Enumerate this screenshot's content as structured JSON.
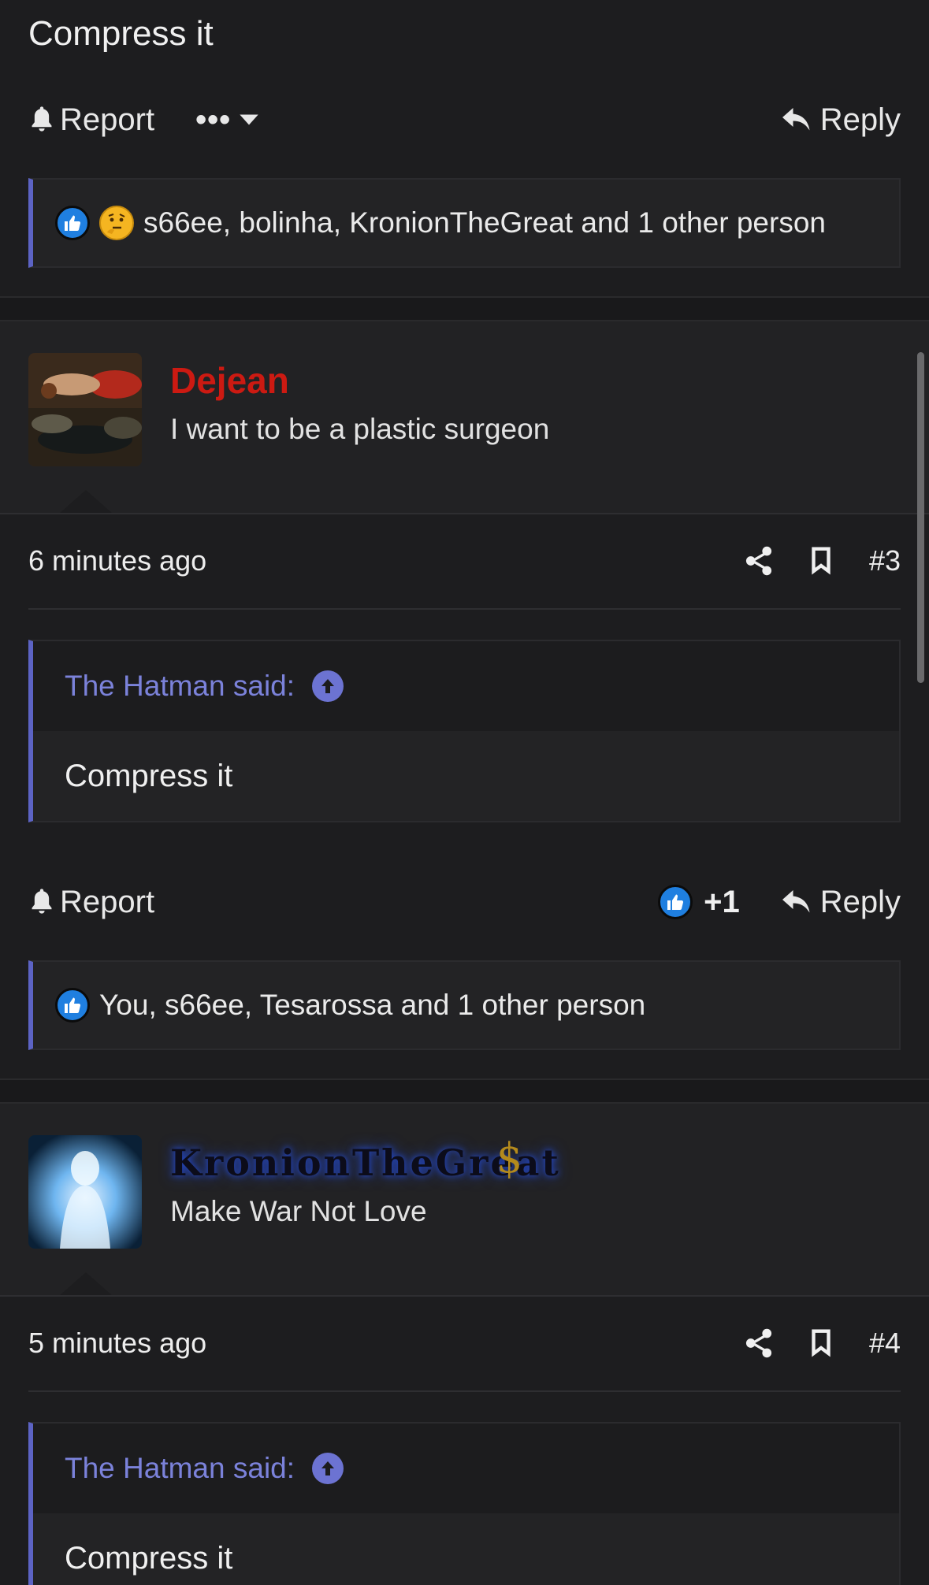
{
  "post2": {
    "body_text": "Compress it",
    "actions": {
      "report": "Report",
      "more": "•••",
      "reply": "Reply"
    },
    "reactions_text": "s66ee, bolinha, KronionTheGreat and 1 other person"
  },
  "post3": {
    "username": "Dejean",
    "user_title": "I want to be a plastic surgeon",
    "username_color": "#cc1a12",
    "timestamp": "6 minutes ago",
    "post_number": "#3",
    "quote": {
      "author": "The Hatman said:",
      "text": "Compress it"
    },
    "actions": {
      "report": "Report",
      "like_count": "+1",
      "reply": "Reply"
    },
    "reactions_text": "You, s66ee, Tesarossa and 1 other person"
  },
  "post4": {
    "username": "KronionTheGreat",
    "user_title": "Make War Not Love",
    "badge": "$",
    "timestamp": "5 minutes ago",
    "post_number": "#4",
    "quote": {
      "author": "The Hatman said:",
      "text": "Compress it"
    }
  },
  "icons": {
    "report": "bell-icon",
    "reply": "reply-arrow-icon",
    "share": "share-icon",
    "bookmark": "bookmark-icon",
    "like": "thumbs-up-icon",
    "thinking": "thinking-face-icon",
    "quote_jump": "arrow-up-circle-icon"
  },
  "colors": {
    "accent": "#5c63c4",
    "like": "#1f7fe0",
    "background": "#1d1d1f"
  }
}
